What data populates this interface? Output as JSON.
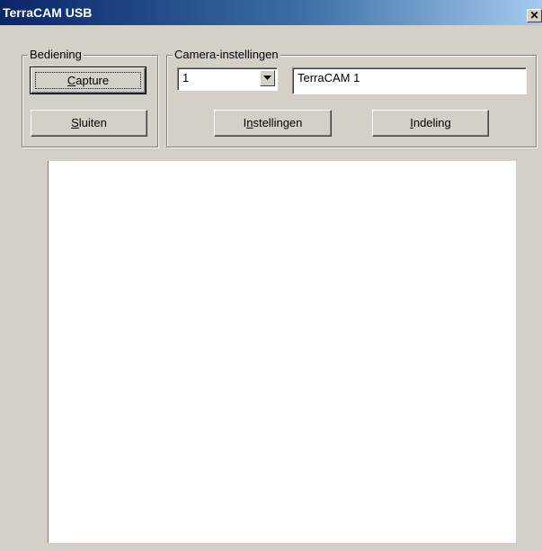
{
  "window": {
    "title": "TerraCAM USB",
    "close_glyph": "✕"
  },
  "bediening": {
    "legend": "Bediening",
    "capture_button": {
      "underlined": "C",
      "rest": "apture"
    },
    "sluiten_button": {
      "underlined": "S",
      "rest": "luiten"
    }
  },
  "camera": {
    "legend": "Camera-instellingen",
    "selected_camera": "1",
    "camera_name": "TerraCAM 1",
    "instellingen_button": {
      "before": "I",
      "underlined": "n",
      "rest": "stellingen"
    },
    "indeling_button": {
      "underlined": "I",
      "rest": "ndeling"
    }
  },
  "colors": {
    "title_gradient_start": "#0a246a",
    "title_gradient_end": "#a6caf0",
    "face": "#d4d0c8"
  }
}
